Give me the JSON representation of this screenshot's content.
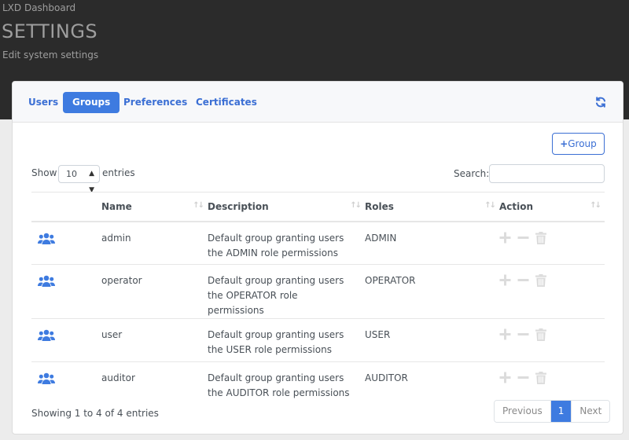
{
  "header": {
    "app_title": "LXD Dashboard",
    "page_title": "SETTINGS",
    "subtitle": "Edit system settings"
  },
  "tabs": [
    {
      "label": "Users",
      "active": false
    },
    {
      "label": "Groups",
      "active": true
    },
    {
      "label": "Preferences",
      "active": false
    },
    {
      "label": "Certificates",
      "active": false
    }
  ],
  "toolbar": {
    "add_group_plus": "+",
    "add_group_label": "Group",
    "refresh_icon": "refresh-icon"
  },
  "controls": {
    "show_label": "Show",
    "entries_value": "10",
    "entries_label": "entries",
    "search_label": "Search:",
    "search_value": ""
  },
  "table": {
    "columns": [
      "",
      "Name",
      "Description",
      "Roles",
      "Action"
    ],
    "rows": [
      {
        "icon": "users-icon",
        "name": "admin",
        "description": "Default group granting users the ADMIN role permissions",
        "roles": "ADMIN"
      },
      {
        "icon": "users-icon",
        "name": "operator",
        "description": "Default group granting users the OPERATOR role permissions",
        "roles": "OPERATOR"
      },
      {
        "icon": "users-icon",
        "name": "user",
        "description": "Default group granting users the USER role permissions",
        "roles": "USER"
      },
      {
        "icon": "users-icon",
        "name": "auditor",
        "description": "Default group granting users the AUDITOR role permissions",
        "roles": "AUDITOR"
      }
    ],
    "action_icons": [
      "plus-icon",
      "minus-icon",
      "trash-icon"
    ]
  },
  "footer": {
    "showing": "Showing 1 to 4 of 4 entries",
    "previous": "Previous",
    "current_page": "1",
    "next": "Next"
  },
  "colors": {
    "accent": "#3e7be0",
    "header_band": "#2b2b2b",
    "disabled_icon": "#dcdcdc"
  }
}
